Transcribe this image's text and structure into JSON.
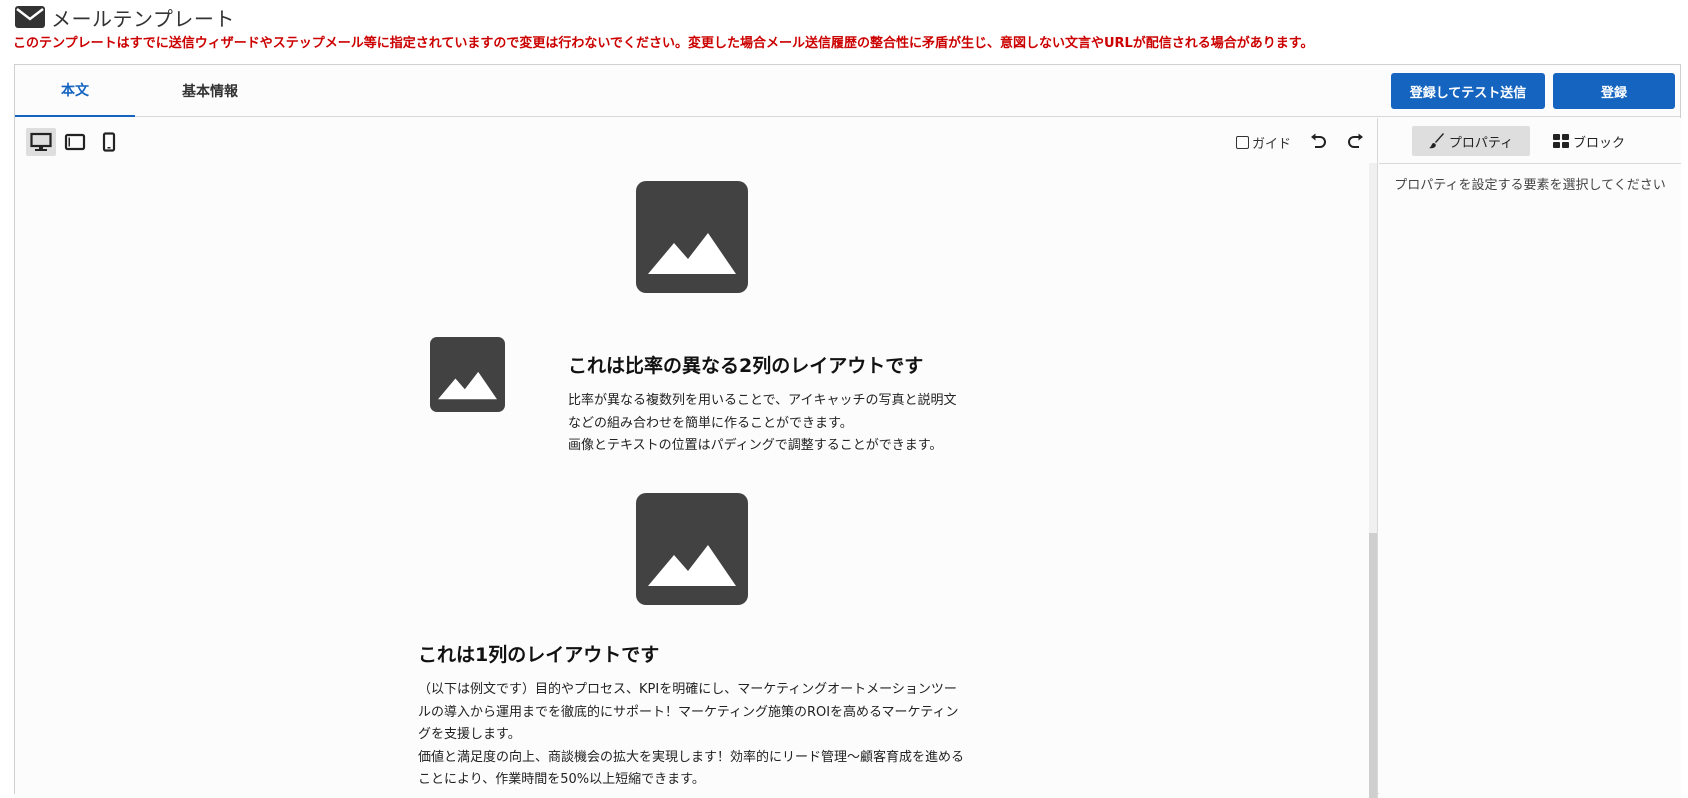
{
  "header": {
    "icon": "mail-icon",
    "title": "メールテンプレート",
    "warning": "このテンプレートはすでに送信ウィザードやステップメール等に指定されていますので変更は行わないでください。変更した場合メール送信履歴の整合性に矛盾が生じ、意図しない文言やURLが配信される場合があります。",
    "warning_color": "#cc0000"
  },
  "tabs": [
    {
      "label": "本文",
      "active": true
    },
    {
      "label": "基本情報",
      "active": false
    }
  ],
  "actions": {
    "test_send_label": "登録してテスト送信",
    "save_label": "登録",
    "accent_color": "#1565c0"
  },
  "toolbar": {
    "devices": [
      {
        "icon": "desktop-icon",
        "active": true
      },
      {
        "icon": "tablet-icon",
        "active": false
      },
      {
        "icon": "mobile-icon",
        "active": false
      }
    ],
    "guide_label": "ガイド",
    "undo_icon": "undo-icon",
    "redo_icon": "redo-icon"
  },
  "content": {
    "two_column": {
      "heading": "これは比率の異なる2列のレイアウトです",
      "lines": [
        "比率が異なる複数列を用いることで、アイキャッチの写真と説明文",
        "などの組み合わせを簡単に作ることができます。",
        "画像とテキストの位置はパディングで調整することができます。"
      ]
    },
    "one_column": {
      "heading": "これは1列のレイアウトです",
      "lines": [
        "（以下は例文です）目的やプロセス、KPIを明確にし、マーケティングオートメーションツー",
        "ルの導入から運用までを徹底的にサポート！マーケティング施策のROIを高めるマーケティン",
        "グを支援します。",
        "価値と満足度の向上、商談機会の拡大を実現します！効率的にリード管理〜顧客育成を進める",
        "ことにより、作業時間を50%以上短縮できます。"
      ]
    }
  },
  "properties": {
    "tabs": [
      {
        "label": "プロパティ",
        "icon": "brush-icon",
        "active": true
      },
      {
        "label": "ブロック",
        "icon": "blocks-icon",
        "active": false
      }
    ],
    "hint": "プロパティを設定する要素を選択してください"
  }
}
